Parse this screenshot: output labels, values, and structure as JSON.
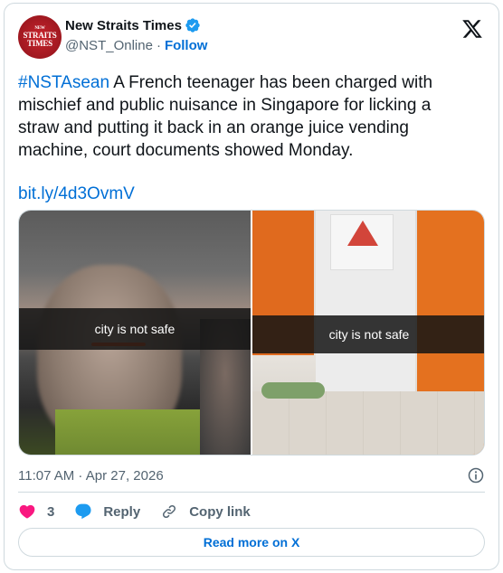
{
  "account": {
    "name": "New Straits Times",
    "handle": "@NST_Online",
    "separator": "·",
    "follow_label": "Follow",
    "avatar_line1": "NEW",
    "avatar_line2": "STRAITS",
    "avatar_line3": "TIMES"
  },
  "tweet": {
    "hashtag": "#NSTAsean",
    "body": " A French teenager has been charged with mischief and public nuisance in Singapore for licking a straw and putting it back in an orange juice vending machine, court documents showed Monday.",
    "link": "bit.ly/4d3OvmV"
  },
  "media": {
    "left_caption": "city is not safe",
    "right_caption": "city is not safe"
  },
  "meta": {
    "timestamp": "11:07 AM · Apr 27, 2026"
  },
  "actions": {
    "like_count": "3",
    "reply_label": "Reply",
    "copy_label": "Copy link"
  },
  "read_more_label": "Read more on X",
  "colors": {
    "link_blue": "#006fd6",
    "like_pink": "#f91880",
    "verified_blue": "#1d9bf0",
    "brand_red": "#c8232c"
  },
  "icons": [
    "verified-badge-icon",
    "x-logo-icon",
    "info-icon",
    "heart-icon",
    "reply-bubble-icon",
    "link-icon"
  ]
}
